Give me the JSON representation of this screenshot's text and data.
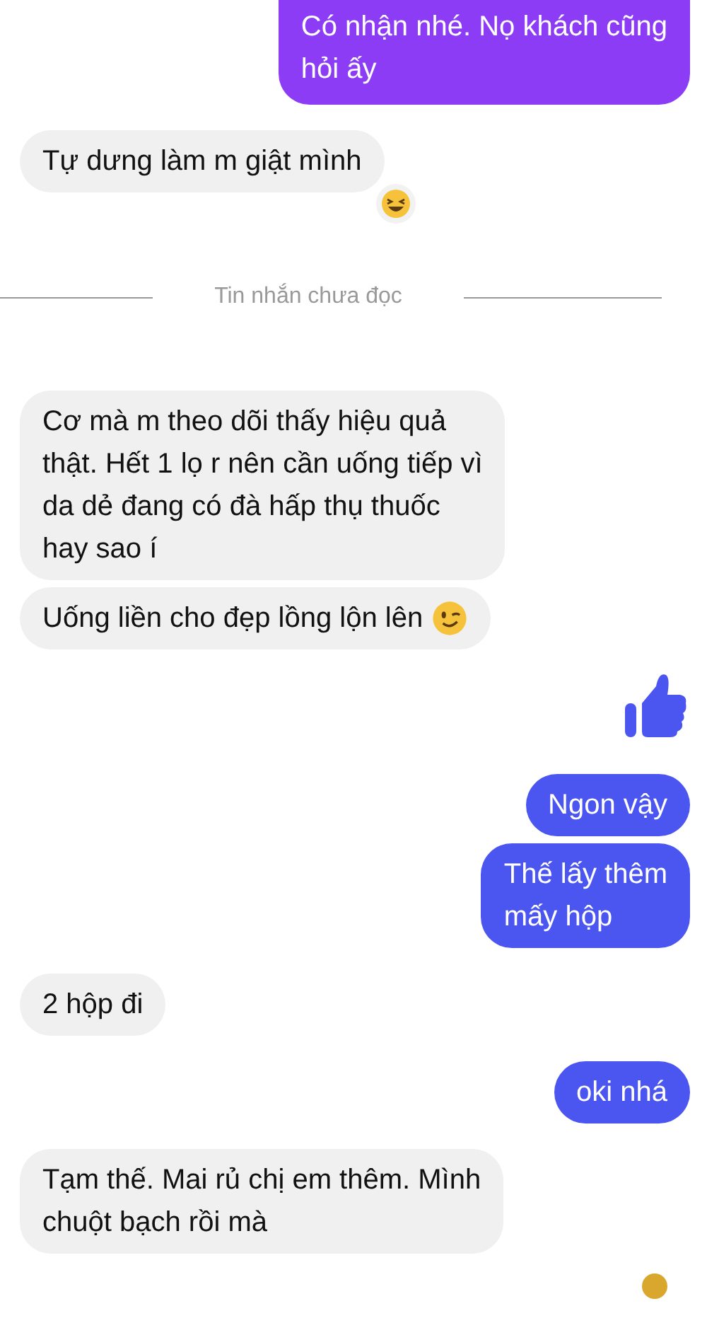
{
  "messages": [
    {
      "kind": "text",
      "outgoing": true,
      "color": "#8c3cf5",
      "text": "Có nhận nhé. Nọ khách cũng\nhỏi ấy",
      "cut_top": true
    },
    {
      "kind": "text",
      "outgoing": false,
      "text": "Tự dưng làm m giật mình",
      "reaction": true
    },
    {
      "kind": "divider",
      "text": "Tin nhắn chưa đọc"
    },
    {
      "kind": "text",
      "outgoing": false,
      "text": "Cơ mà m theo dõi thấy hiệu quả\nthật. Hết 1 lọ r nên cần uống tiếp vì\nda dẻ đang có đà hấp thụ thuốc\nhay sao í"
    },
    {
      "kind": "text",
      "outgoing": false,
      "text": "Uống liền cho đẹp lồng lộn lên",
      "wink": true
    },
    {
      "kind": "like",
      "color": "#4b55f0"
    },
    {
      "kind": "text",
      "outgoing": true,
      "color": "#4b55f0",
      "text": "Ngon vậy"
    },
    {
      "kind": "text",
      "outgoing": true,
      "color": "#4b55f0",
      "text": "Thế lấy thêm\nmấy hộp"
    },
    {
      "kind": "text",
      "outgoing": false,
      "text": "2 hộp đi"
    },
    {
      "kind": "text",
      "outgoing": true,
      "color": "#4b55f0",
      "text": "oki nhá"
    },
    {
      "kind": "text",
      "outgoing": false,
      "text": "Tạm thế. Mai rủ chị em thêm. Mình\nchuột bạch rồi mà"
    },
    {
      "kind": "seen"
    }
  ]
}
